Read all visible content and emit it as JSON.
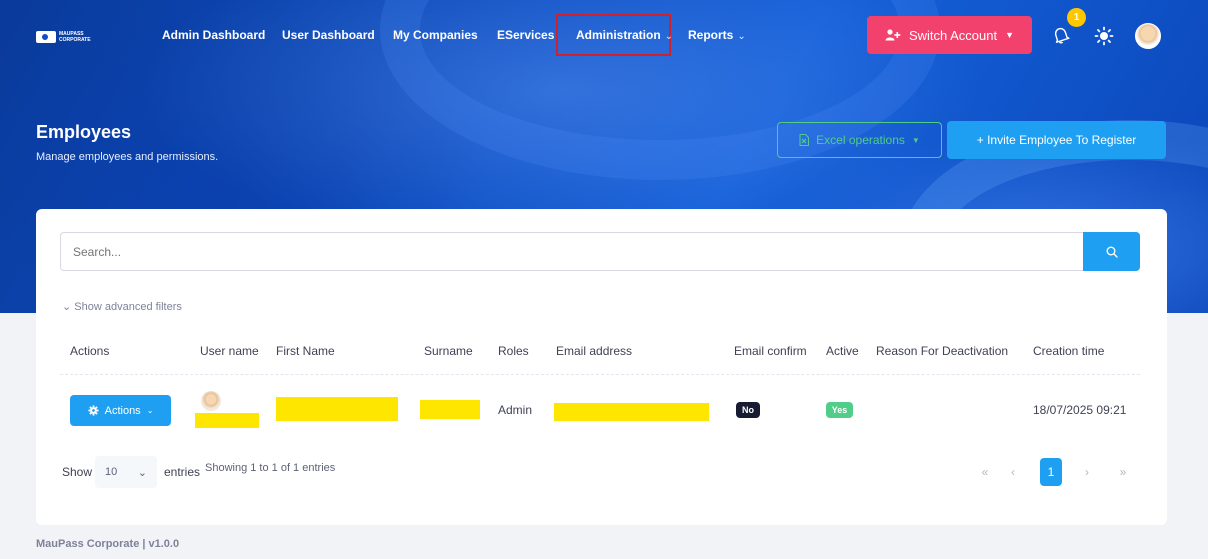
{
  "brand": {
    "logo_line1": "MAUPASS",
    "logo_line2": "CORPORATE"
  },
  "nav": {
    "items": [
      {
        "label": "Admin Dashboard"
      },
      {
        "label": "User Dashboard"
      },
      {
        "label": "My Companies"
      },
      {
        "label": "EServices"
      },
      {
        "label": "Administration",
        "has_dropdown": true,
        "highlighted": true
      },
      {
        "label": "Reports",
        "has_dropdown": true
      }
    ],
    "switch_account": "Switch Account",
    "notification_count": "1",
    "icons": [
      "user-plus-icon",
      "bell-icon",
      "sun-icon",
      "avatar"
    ]
  },
  "header": {
    "title": "Employees",
    "subtitle": "Manage employees and permissions.",
    "excel_button": "Excel operations",
    "invite_button": "+ Invite Employee To Register"
  },
  "search": {
    "placeholder": "Search...",
    "advanced_filters": "Show advanced filters"
  },
  "table": {
    "columns": [
      "Actions",
      "User name",
      "First Name",
      "Surname",
      "Roles",
      "Email address",
      "Email confirm",
      "Active",
      "Reason For Deactivation",
      "Creation time"
    ],
    "rows": [
      {
        "actions_label": "Actions",
        "user_name": "[redacted]",
        "first_name": "[redacted]",
        "surname": "[redacted]",
        "roles": "Admin",
        "email": "[redacted]",
        "email_confirm": "No",
        "active": "Yes",
        "reason": "",
        "creation_time": "18/07/2025 09:21"
      }
    ]
  },
  "pagination": {
    "show_label": "Show",
    "page_size": "10",
    "entries_label": "entries",
    "summary": "Showing 1 to 1 of 1 entries",
    "first": "«",
    "prev": "‹",
    "current": "1",
    "next": "›",
    "last": "»"
  },
  "footer": {
    "text": "MauPass Corporate | v1.0.0"
  },
  "colors": {
    "primary": "#1e9ff2",
    "danger": "#f1416c",
    "success": "#50cd89",
    "warning": "#ffc700",
    "dark": "#181c32",
    "redaction": "#ffe600",
    "highlight_border": "#d0202a"
  }
}
